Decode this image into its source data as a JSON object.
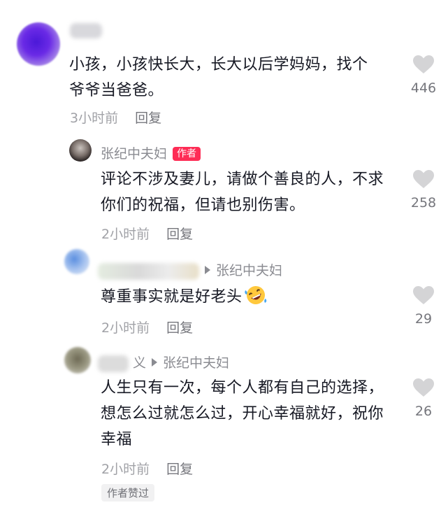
{
  "comments": [
    {
      "name": "",
      "text": "小孩，小孩快长大，长大以后学妈妈，找个爷爷当爸爸。",
      "line1": "小孩，小孩快长大，长大以后学妈妈，找个",
      "line2": "爷爷当爸爸。",
      "time": "3小时前",
      "reply_label": "回复",
      "likes": "446",
      "avatar_icon": "blurred-purple-avatar"
    },
    {
      "name": "张纪中夫妇",
      "badge": "作者",
      "line1": "评论不涉及妻儿，请做个善良的人，不求",
      "line2": "你们的祝福，但请也别伤害。",
      "time": "2小时前",
      "reply_label": "回复",
      "likes": "258",
      "avatar_icon": "author-avatar"
    },
    {
      "reply_to": "张纪中夫妇",
      "line1": "尊重事实就是好老头",
      "emoji": "rofl-emoji",
      "time": "2小时前",
      "reply_label": "回复",
      "likes": "29",
      "avatar_icon": "blurred-blue-avatar"
    },
    {
      "name_tail": "义",
      "reply_to": "张纪中夫妇",
      "line1": "人生只有一次，每个人都有自己的选择，",
      "line2": "想怎么过就怎么过，开心幸福就好，祝你",
      "line3": "幸福",
      "time": "2小时前",
      "reply_label": "回复",
      "likes": "26",
      "author_liked": "作者赞过",
      "avatar_icon": "blurred-gray-avatar"
    }
  ],
  "colors": {
    "accent": "#fe2c55",
    "heart": "#d4d4d6",
    "text": "#161823",
    "meta": "#a1a2a7"
  }
}
